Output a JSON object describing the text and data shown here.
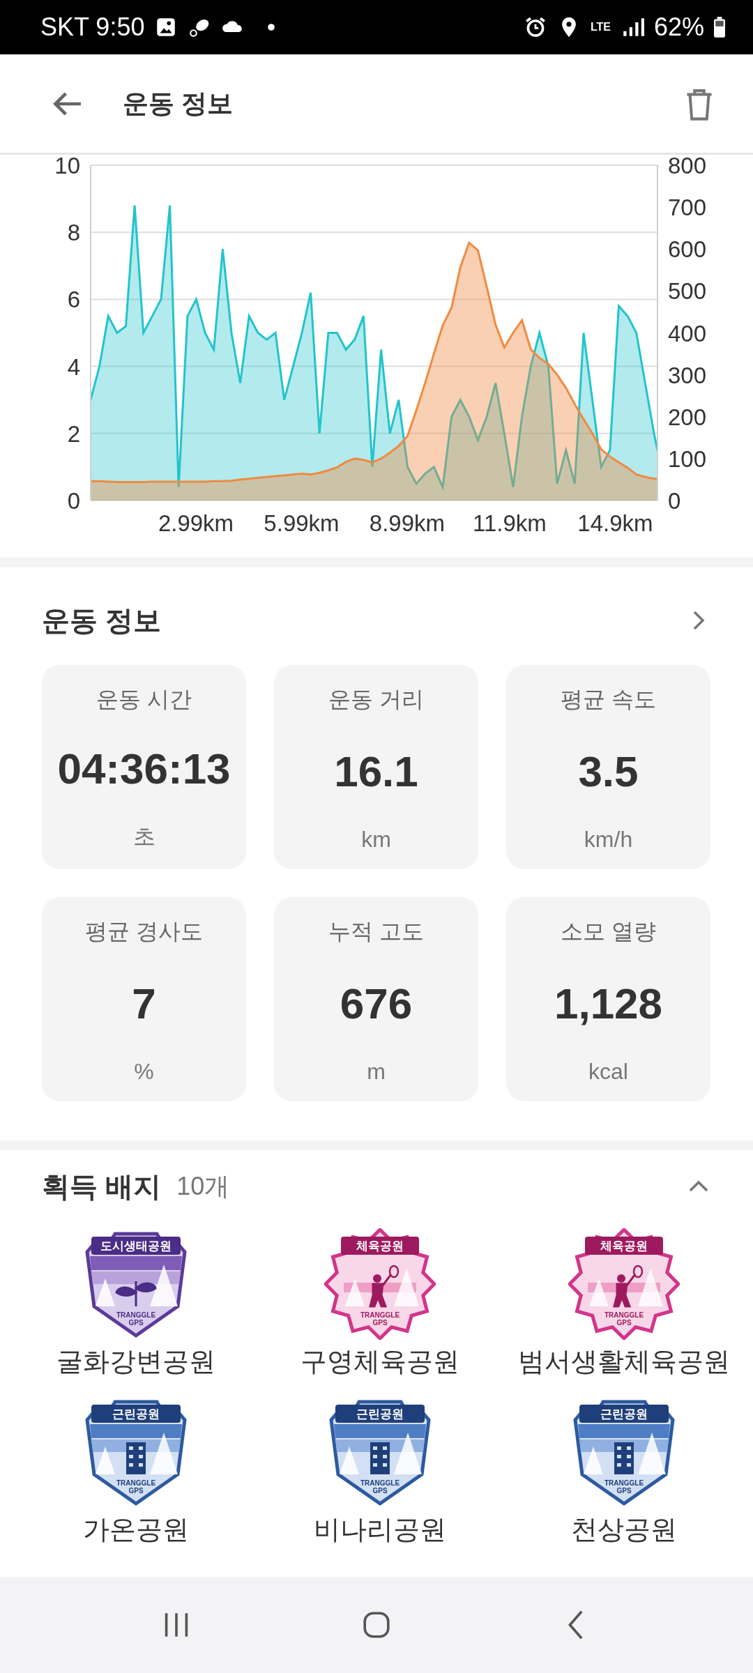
{
  "status_bar": {
    "carrier_time": "SKT 9:50",
    "network": "LTE",
    "battery": "62%"
  },
  "header": {
    "title": "운동 정보"
  },
  "chart_data": {
    "type": "area",
    "grid": true,
    "xlim": [
      0,
      16.1
    ],
    "ylim": [
      0,
      10
    ],
    "y2lim": [
      0,
      800
    ],
    "x": [
      0,
      0.25,
      0.5,
      0.75,
      1,
      1.25,
      1.5,
      1.75,
      2,
      2.25,
      2.5,
      2.75,
      3,
      3.25,
      3.5,
      3.75,
      4,
      4.25,
      4.5,
      4.75,
      5,
      5.25,
      5.5,
      5.75,
      6,
      6.25,
      6.5,
      6.75,
      7,
      7.25,
      7.5,
      7.75,
      8,
      8.25,
      8.5,
      8.75,
      9,
      9.25,
      9.5,
      9.75,
      10,
      10.25,
      10.5,
      10.75,
      11,
      11.25,
      11.5,
      11.75,
      12,
      12.25,
      12.5,
      12.75,
      13,
      13.25,
      13.5,
      13.75,
      14,
      14.25,
      14.5,
      14.75,
      15,
      15.25,
      15.5,
      15.75,
      16,
      16.1
    ],
    "series": [
      {
        "color": "#22c4cc",
        "values": [
          3,
          4,
          5.5,
          5,
          5.2,
          8.8,
          5,
          5.5,
          6,
          8.8,
          0.4,
          5.5,
          6,
          5,
          4.5,
          7.5,
          5,
          3.5,
          5.5,
          5,
          4.8,
          5,
          3,
          4,
          5,
          6.2,
          2,
          5,
          5,
          4.5,
          4.8,
          5.5,
          1,
          4.5,
          2,
          3,
          1,
          0.5,
          0.8,
          1,
          0.4,
          2.5,
          3,
          2.5,
          1.8,
          2.5,
          3.5,
          2,
          0.4,
          2.5,
          4,
          5,
          4,
          0.5,
          1.5,
          0.5,
          5,
          3,
          1,
          1.5,
          5.8,
          5.5,
          5,
          3.5,
          2,
          1.5
        ]
      },
      {
        "axis": "y2",
        "color": "#f08a40",
        "values": [
          46,
          46,
          45,
          44,
          44,
          44,
          44,
          45,
          45,
          45,
          45,
          45,
          45,
          45,
          46,
          46,
          47,
          50,
          52,
          54,
          56,
          58,
          60,
          62,
          64,
          62,
          66,
          72,
          79,
          92,
          100,
          97,
          91,
          100,
          114,
          130,
          154,
          215,
          280,
          350,
          418,
          460,
          556,
          615,
          597,
          510,
          420,
          365,
          400,
          430,
          361,
          340,
          326,
          300,
          269,
          230,
          194,
          160,
          122,
          105,
          91,
          78,
          62,
          56,
          52,
          51
        ]
      }
    ],
    "xticks": [
      {
        "value": 2.99,
        "label": "2.99km"
      },
      {
        "value": 5.99,
        "label": "5.99km"
      },
      {
        "value": 8.99,
        "label": "8.99km"
      },
      {
        "value": 11.9,
        "label": "11.9km"
      },
      {
        "value": 14.9,
        "label": "14.9km"
      }
    ],
    "yticks": [
      0,
      2,
      4,
      6,
      8,
      10
    ],
    "y2ticks": [
      0,
      100,
      200,
      300,
      400,
      500,
      600,
      700,
      800
    ]
  },
  "summary": {
    "title": "운동 정보",
    "stats": [
      {
        "label": "운동 시간",
        "value": "04:36:13",
        "unit": "초"
      },
      {
        "label": "운동 거리",
        "value": "16.1",
        "unit": "km"
      },
      {
        "label": "평균 속도",
        "value": "3.5",
        "unit": "km/h"
      },
      {
        "label": "평균 경사도",
        "value": "7",
        "unit": "%"
      },
      {
        "label": "누적 고도",
        "value": "676",
        "unit": "m"
      },
      {
        "label": "소모 열량",
        "value": "1,128",
        "unit": "kcal"
      }
    ]
  },
  "badges": {
    "title": "획득 배지",
    "count": "10개",
    "expanded": true,
    "items": [
      {
        "kind": "eco",
        "emblem": "도시생태공원",
        "brand": "TRANGGLE",
        "brand_sub": "GPS",
        "label": "굴화강변공원"
      },
      {
        "kind": "sport",
        "emblem": "체육공원",
        "brand": "TRANGGLE",
        "brand_sub": "GPS",
        "label": "구영체육공원"
      },
      {
        "kind": "sport",
        "emblem": "체육공원",
        "brand": "TRANGGLE",
        "brand_sub": "GPS",
        "label": "범서생활체육공원"
      },
      {
        "kind": "neighborhood",
        "emblem": "근린공원",
        "brand": "TRANGGLE",
        "brand_sub": "GPS",
        "label": "가온공원"
      },
      {
        "kind": "neighborhood",
        "emblem": "근린공원",
        "brand": "TRANGGLE",
        "brand_sub": "GPS",
        "label": "비나리공원"
      },
      {
        "kind": "neighborhood",
        "emblem": "근린공원",
        "brand": "TRANGGLE",
        "brand_sub": "GPS",
        "label": "천상공원"
      }
    ]
  }
}
